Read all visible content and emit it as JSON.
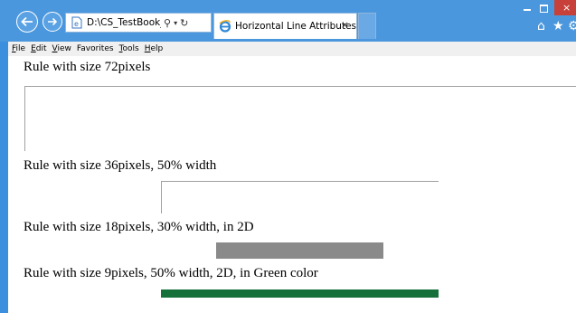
{
  "browser": {
    "address": "D:\\CS_TestBook_Final\\",
    "address_search_icon": "search-icon",
    "address_refresh_icon": "refresh-icon",
    "tab_title": "Horizontal Line Attributes",
    "tab_close": "×",
    "window_close": "×",
    "home_icon": "⌂",
    "star_icon": "★",
    "gear_icon": "⚙"
  },
  "menu": {
    "items": [
      {
        "u": "F",
        "rest": "ile"
      },
      {
        "u": "E",
        "rest": "dit"
      },
      {
        "u": "V",
        "rest": "iew"
      },
      {
        "u": "Fa",
        "rest": "vorites",
        "prefix": ""
      },
      {
        "u": "T",
        "rest": "ools"
      },
      {
        "u": "H",
        "rest": "elp"
      }
    ]
  },
  "page": {
    "label_1": "Rule with size 72pixels",
    "label_2": "Rule with size 36pixels, 50% width",
    "label_3": "Rule with size 18pixels, 30% width, in 2D",
    "label_4": "Rule with size 9pixels, 50% width, 2D, in Green color",
    "green_color": "#16703a"
  }
}
